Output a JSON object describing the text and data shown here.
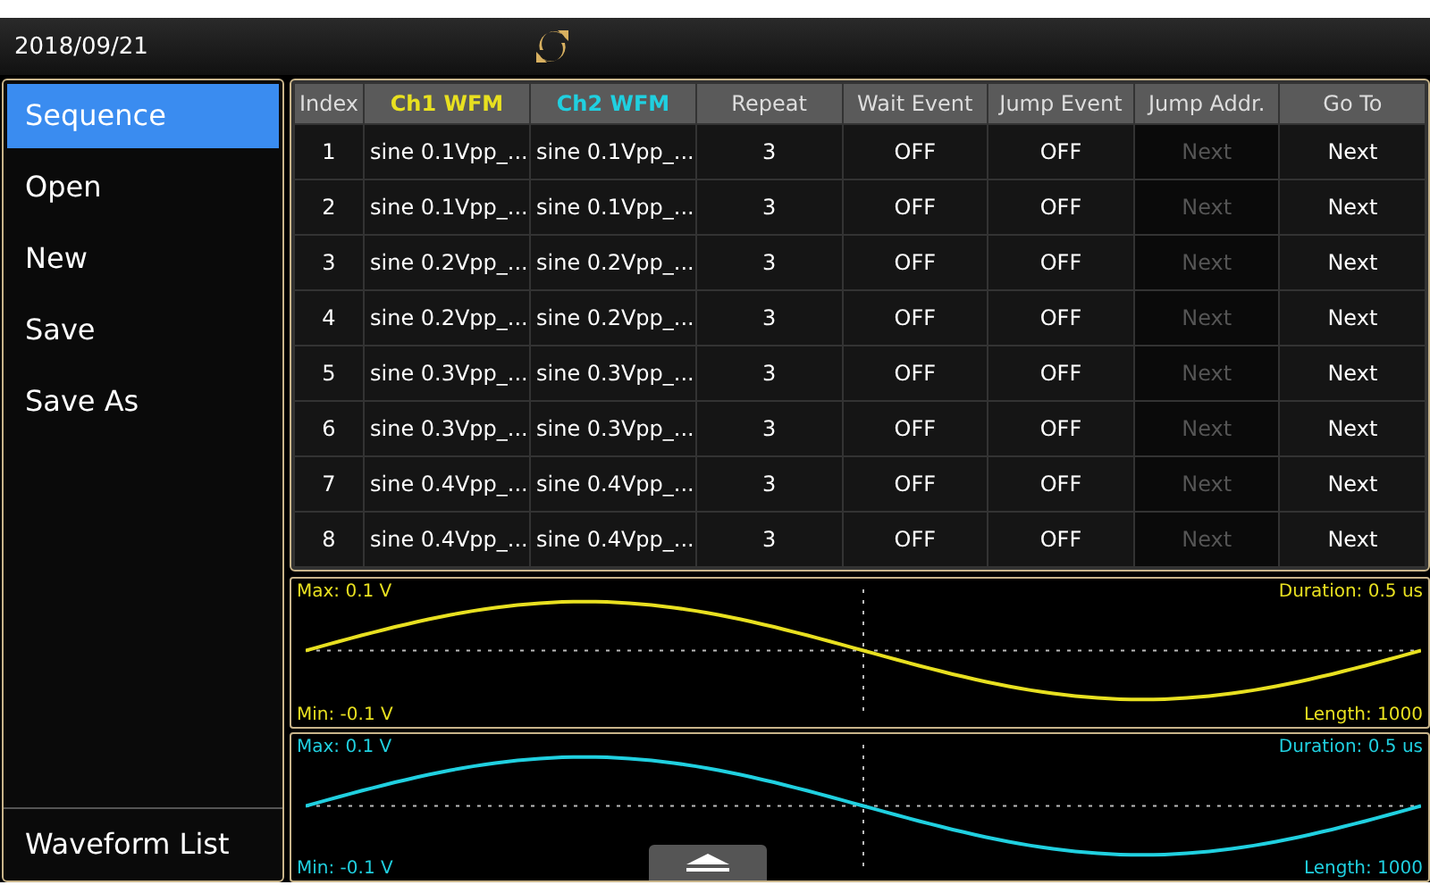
{
  "status_bar": {
    "date": "2018/09/21"
  },
  "sidebar": {
    "items": [
      {
        "label": "Sequence",
        "selected": true
      },
      {
        "label": "Open",
        "selected": false
      },
      {
        "label": "New",
        "selected": false
      },
      {
        "label": "Save",
        "selected": false
      },
      {
        "label": "Save As",
        "selected": false
      }
    ],
    "bottom_item": {
      "label": "Waveform List",
      "selected": false
    }
  },
  "table": {
    "columns": [
      {
        "label": "Index"
      },
      {
        "label": "Ch1 WFM",
        "color": "#e8e020"
      },
      {
        "label": "Ch2 WFM",
        "color": "#20d0e0"
      },
      {
        "label": "Repeat"
      },
      {
        "label": "Wait Event"
      },
      {
        "label": "Jump Event"
      },
      {
        "label": "Jump Addr."
      },
      {
        "label": "Go To"
      }
    ],
    "rows": [
      {
        "cells": [
          "1",
          "sine 0.1Vpp_...",
          "sine 0.1Vpp_...",
          "3",
          "OFF",
          "OFF",
          "Next",
          "Next"
        ],
        "disabled": [
          false,
          false,
          false,
          false,
          false,
          false,
          true,
          false
        ]
      },
      {
        "cells": [
          "2",
          "sine 0.1Vpp_...",
          "sine 0.1Vpp_...",
          "3",
          "OFF",
          "OFF",
          "Next",
          "Next"
        ],
        "disabled": [
          false,
          false,
          false,
          false,
          false,
          false,
          true,
          false
        ]
      },
      {
        "cells": [
          "3",
          "sine 0.2Vpp_...",
          "sine 0.2Vpp_...",
          "3",
          "OFF",
          "OFF",
          "Next",
          "Next"
        ],
        "disabled": [
          false,
          false,
          false,
          false,
          false,
          false,
          true,
          false
        ]
      },
      {
        "cells": [
          "4",
          "sine 0.2Vpp_...",
          "sine 0.2Vpp_...",
          "3",
          "OFF",
          "OFF",
          "Next",
          "Next"
        ],
        "disabled": [
          false,
          false,
          false,
          false,
          false,
          false,
          true,
          false
        ]
      },
      {
        "cells": [
          "5",
          "sine 0.3Vpp_...",
          "sine 0.3Vpp_...",
          "3",
          "OFF",
          "OFF",
          "Next",
          "Next"
        ],
        "disabled": [
          false,
          false,
          false,
          false,
          false,
          false,
          true,
          false
        ]
      },
      {
        "cells": [
          "6",
          "sine 0.3Vpp_...",
          "sine 0.3Vpp_...",
          "3",
          "OFF",
          "OFF",
          "Next",
          "Next"
        ],
        "disabled": [
          false,
          false,
          false,
          false,
          false,
          false,
          true,
          false
        ]
      },
      {
        "cells": [
          "7",
          "sine 0.4Vpp_...",
          "sine 0.4Vpp_...",
          "3",
          "OFF",
          "OFF",
          "Next",
          "Next"
        ],
        "disabled": [
          false,
          false,
          false,
          false,
          false,
          false,
          true,
          false
        ]
      },
      {
        "cells": [
          "8",
          "sine 0.4Vpp_...",
          "sine 0.4Vpp_...",
          "3",
          "OFF",
          "OFF",
          "Next",
          "Next"
        ],
        "disabled": [
          false,
          false,
          false,
          false,
          false,
          false,
          true,
          false
        ]
      }
    ]
  },
  "waveforms": [
    {
      "color": "#e8e020",
      "max": "Max: 0.1 V",
      "min": "Min: -0.1 V",
      "duration": "Duration: 0.5 us",
      "length": "Length: 1000"
    },
    {
      "color": "#20d0e0",
      "max": "Max: 0.1 V",
      "min": "Min: -0.1 V",
      "duration": "Duration: 0.5 us",
      "length": "Length: 1000"
    }
  ]
}
